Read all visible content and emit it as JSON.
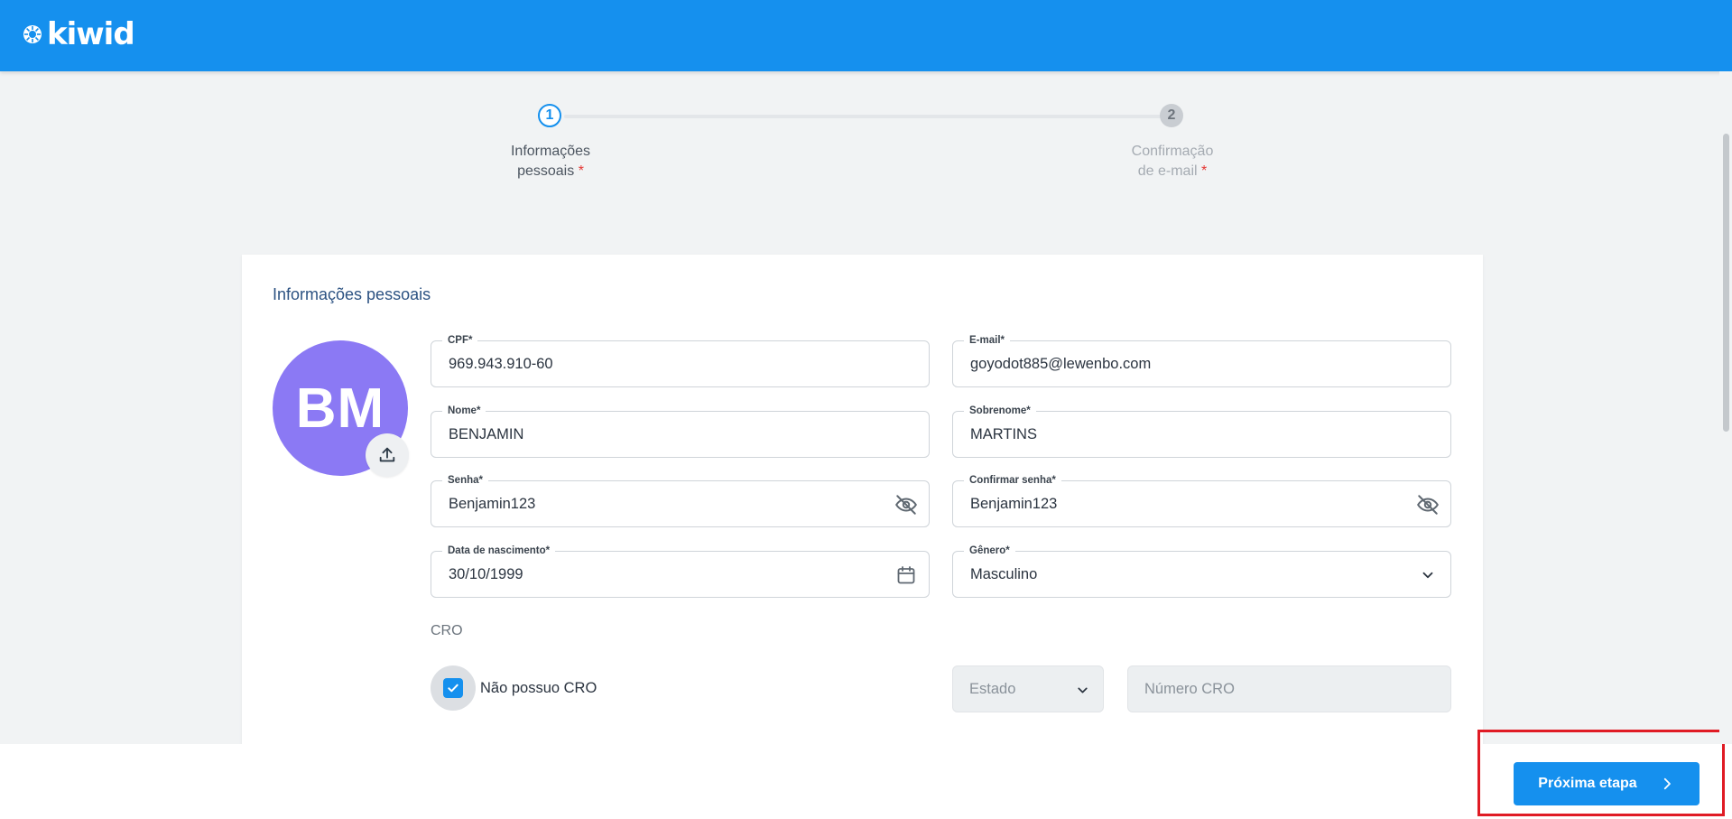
{
  "app": {
    "brand": "kiwid",
    "colors": {
      "primary": "#1590ee",
      "avatar": "#8b79f4",
      "required": "#e53935",
      "highlight": "#e01b24"
    }
  },
  "stepper": {
    "steps": [
      {
        "number": "1",
        "line1": "Informações",
        "line2": "pessoais",
        "required": "*",
        "active": true
      },
      {
        "number": "2",
        "line1": "Confirmação",
        "line2": "de e-mail",
        "required": "*",
        "active": false
      }
    ]
  },
  "form": {
    "title": "Informações pessoais",
    "avatar": {
      "initials": "BM",
      "upload_icon": "upload-icon"
    },
    "fields": {
      "cpf": {
        "label": "CPF",
        "value": "969.943.910-60"
      },
      "email": {
        "label": "E-mail",
        "value": "goyodot885@lewenbo.com"
      },
      "nome": {
        "label": "Nome",
        "value": "BENJAMIN"
      },
      "sobrenome": {
        "label": "Sobrenome",
        "value": "MARTINS"
      },
      "senha": {
        "label": "Senha",
        "value": "Benjamin123",
        "icon": "eye-off-icon"
      },
      "confirmar_senha": {
        "label": "Confirmar senha",
        "value": "Benjamin123",
        "icon": "eye-off-icon"
      },
      "nascimento": {
        "label": "Data de nascimento",
        "value": "30/10/1999",
        "icon": "calendar-icon"
      },
      "genero": {
        "label": "Gênero",
        "value": "Masculino",
        "icon": "chevron-down-icon"
      }
    },
    "required_mark": "*",
    "cro": {
      "section_label": "CRO",
      "no_cro_label": "Não possuo CRO",
      "no_cro_checked": true,
      "estado_placeholder": "Estado",
      "numero_placeholder": "Número CRO"
    }
  },
  "footer": {
    "next_label": "Próxima etapa",
    "next_icon": "chevron-right-icon"
  }
}
